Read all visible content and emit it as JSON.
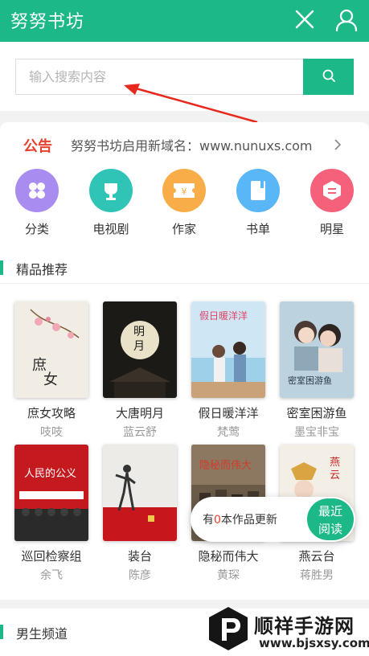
{
  "app": {
    "title": "努努书坊"
  },
  "search": {
    "placeholder": "输入搜索内容"
  },
  "notice": {
    "tag": "公告",
    "text": "努努书坊启用新域名：www.nunuxs.com"
  },
  "categories": [
    {
      "label": "分类",
      "icon": "category-icon",
      "color": "#a98cf0"
    },
    {
      "label": "电视剧",
      "icon": "trophy-icon",
      "color": "#2fc4b6"
    },
    {
      "label": "作家",
      "icon": "ticket-icon",
      "color": "#f9ad48"
    },
    {
      "label": "书单",
      "icon": "book-icon",
      "color": "#59b6f7"
    },
    {
      "label": "明星",
      "icon": "star-badge-icon",
      "color": "#f5607a"
    }
  ],
  "featured": {
    "title": "精品推荐",
    "books": [
      {
        "title": "庶女攻略",
        "author": "吱吱"
      },
      {
        "title": "大唐明月",
        "author": "蓝云舒"
      },
      {
        "title": "假日暖洋洋",
        "author": "梵莺"
      },
      {
        "title": "密室困游鱼",
        "author": "墨宝非宝"
      },
      {
        "title": "巡回检察组",
        "author": "余飞"
      },
      {
        "title": "装台",
        "author": "陈彦"
      },
      {
        "title": "隐秘而伟大",
        "author": "黄琛"
      },
      {
        "title": "燕云台",
        "author": "蒋胜男"
      }
    ]
  },
  "update": {
    "prefix": "有",
    "count": "0",
    "suffix": "本作品更新",
    "button_line1": "最近",
    "button_line2": "阅读"
  },
  "male_channel": {
    "title": "男生频道"
  },
  "watermark": {
    "name": "顺祥手游网",
    "url": "www.bjsxsy.com"
  },
  "colors": {
    "accent": "#1db887",
    "notice_red": "#e8412f"
  }
}
